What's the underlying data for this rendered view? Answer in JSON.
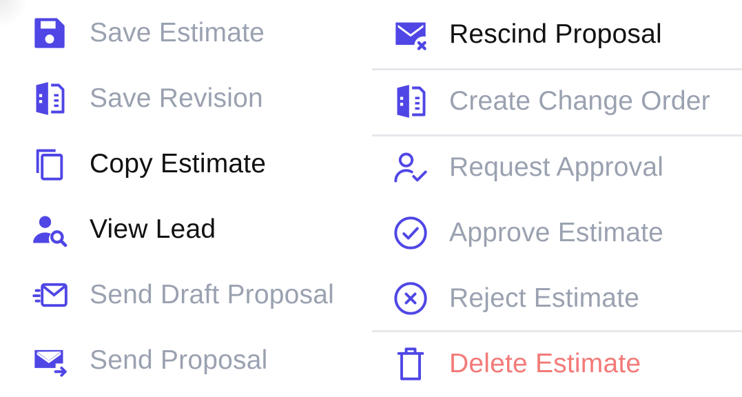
{
  "colors": {
    "icon": "#4f46e5",
    "enabled_text": "#111111",
    "disabled_text": "#9aa1b0",
    "danger_text": "#f27a78",
    "divider": "#e5e7eb"
  },
  "left_items": [
    {
      "label": "Save Estimate",
      "icon": "save-icon",
      "state": "disabled"
    },
    {
      "label": "Save Revision",
      "icon": "revision-document-icon",
      "state": "disabled"
    },
    {
      "label": "Copy Estimate",
      "icon": "copy-icon",
      "state": "enabled"
    },
    {
      "label": "View Lead",
      "icon": "user-search-icon",
      "state": "enabled"
    },
    {
      "label": "Send Draft Proposal",
      "icon": "send-mail-icon",
      "state": "disabled"
    },
    {
      "label": "Send Proposal",
      "icon": "mail-forward-icon",
      "state": "disabled"
    }
  ],
  "right_items": [
    {
      "label": "Rescind Proposal",
      "icon": "mail-x-icon",
      "state": "enabled"
    },
    {
      "label": "Create Change Order",
      "icon": "change-order-document-icon",
      "state": "disabled"
    },
    {
      "label": "Request Approval",
      "icon": "user-check-icon",
      "state": "disabled"
    },
    {
      "label": "Approve Estimate",
      "icon": "check-circle-icon",
      "state": "disabled"
    },
    {
      "label": "Reject Estimate",
      "icon": "x-circle-icon",
      "state": "disabled"
    },
    {
      "label": "Delete Estimate",
      "icon": "trash-icon",
      "state": "danger"
    }
  ]
}
